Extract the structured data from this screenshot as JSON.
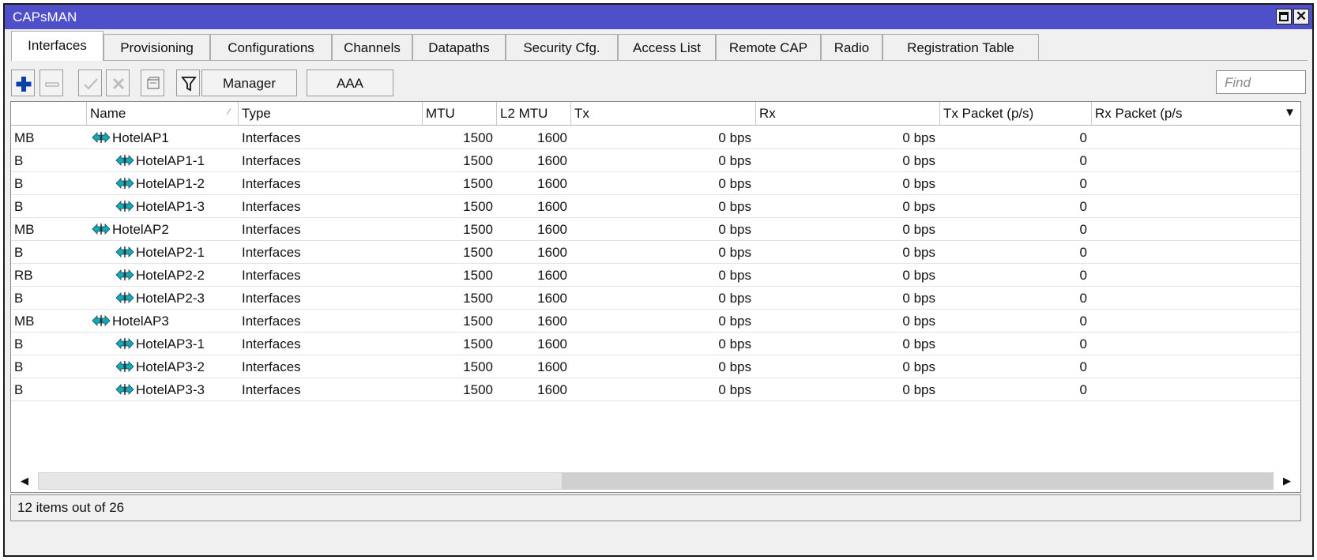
{
  "window": {
    "title": "CAPsMAN"
  },
  "tabs": [
    "Interfaces",
    "Provisioning",
    "Configurations",
    "Channels",
    "Datapaths",
    "Security Cfg.",
    "Access List",
    "Remote CAP",
    "Radio",
    "Registration Table"
  ],
  "toolbar": {
    "manager_label": "Manager",
    "aaa_label": "AAA",
    "find_placeholder": "Find"
  },
  "table": {
    "columns": [
      "",
      "Name",
      "Type",
      "MTU",
      "L2 MTU",
      "Tx",
      "Rx",
      "Tx Packet (p/s)",
      "Rx Packet (p/s"
    ],
    "rows": [
      {
        "flags": "MB",
        "name": "HotelAP1",
        "indent": 0,
        "type": "Interfaces",
        "mtu": "1500",
        "l2mtu": "1600",
        "tx": "0 bps",
        "rx": "0 bps",
        "txp": "0",
        "rxp": ""
      },
      {
        "flags": "B",
        "name": "HotelAP1-1",
        "indent": 1,
        "type": "Interfaces",
        "mtu": "1500",
        "l2mtu": "1600",
        "tx": "0 bps",
        "rx": "0 bps",
        "txp": "0",
        "rxp": ""
      },
      {
        "flags": "B",
        "name": "HotelAP1-2",
        "indent": 1,
        "type": "Interfaces",
        "mtu": "1500",
        "l2mtu": "1600",
        "tx": "0 bps",
        "rx": "0 bps",
        "txp": "0",
        "rxp": ""
      },
      {
        "flags": "B",
        "name": "HotelAP1-3",
        "indent": 1,
        "type": "Interfaces",
        "mtu": "1500",
        "l2mtu": "1600",
        "tx": "0 bps",
        "rx": "0 bps",
        "txp": "0",
        "rxp": ""
      },
      {
        "flags": "MB",
        "name": "HotelAP2",
        "indent": 0,
        "type": "Interfaces",
        "mtu": "1500",
        "l2mtu": "1600",
        "tx": "0 bps",
        "rx": "0 bps",
        "txp": "0",
        "rxp": ""
      },
      {
        "flags": "B",
        "name": "HotelAP2-1",
        "indent": 1,
        "type": "Interfaces",
        "mtu": "1500",
        "l2mtu": "1600",
        "tx": "0 bps",
        "rx": "0 bps",
        "txp": "0",
        "rxp": ""
      },
      {
        "flags": "RB",
        "name": "HotelAP2-2",
        "indent": 1,
        "type": "Interfaces",
        "mtu": "1500",
        "l2mtu": "1600",
        "tx": "0 bps",
        "rx": "0 bps",
        "txp": "0",
        "rxp": ""
      },
      {
        "flags": "B",
        "name": "HotelAP2-3",
        "indent": 1,
        "type": "Interfaces",
        "mtu": "1500",
        "l2mtu": "1600",
        "tx": "0 bps",
        "rx": "0 bps",
        "txp": "0",
        "rxp": ""
      },
      {
        "flags": "MB",
        "name": "HotelAP3",
        "indent": 0,
        "type": "Interfaces",
        "mtu": "1500",
        "l2mtu": "1600",
        "tx": "0 bps",
        "rx": "0 bps",
        "txp": "0",
        "rxp": ""
      },
      {
        "flags": "B",
        "name": "HotelAP3-1",
        "indent": 1,
        "type": "Interfaces",
        "mtu": "1500",
        "l2mtu": "1600",
        "tx": "0 bps",
        "rx": "0 bps",
        "txp": "0",
        "rxp": ""
      },
      {
        "flags": "B",
        "name": "HotelAP3-2",
        "indent": 1,
        "type": "Interfaces",
        "mtu": "1500",
        "l2mtu": "1600",
        "tx": "0 bps",
        "rx": "0 bps",
        "txp": "0",
        "rxp": ""
      },
      {
        "flags": "B",
        "name": "HotelAP3-3",
        "indent": 1,
        "type": "Interfaces",
        "mtu": "1500",
        "l2mtu": "1600",
        "tx": "0 bps",
        "rx": "0 bps",
        "txp": "0",
        "rxp": ""
      }
    ]
  },
  "status": {
    "text": "12 items out of 26"
  },
  "colors": {
    "titlebar": "#4f4fc9",
    "add_icon": "#0b3fa8",
    "interface_icon": "#17a8b5"
  }
}
